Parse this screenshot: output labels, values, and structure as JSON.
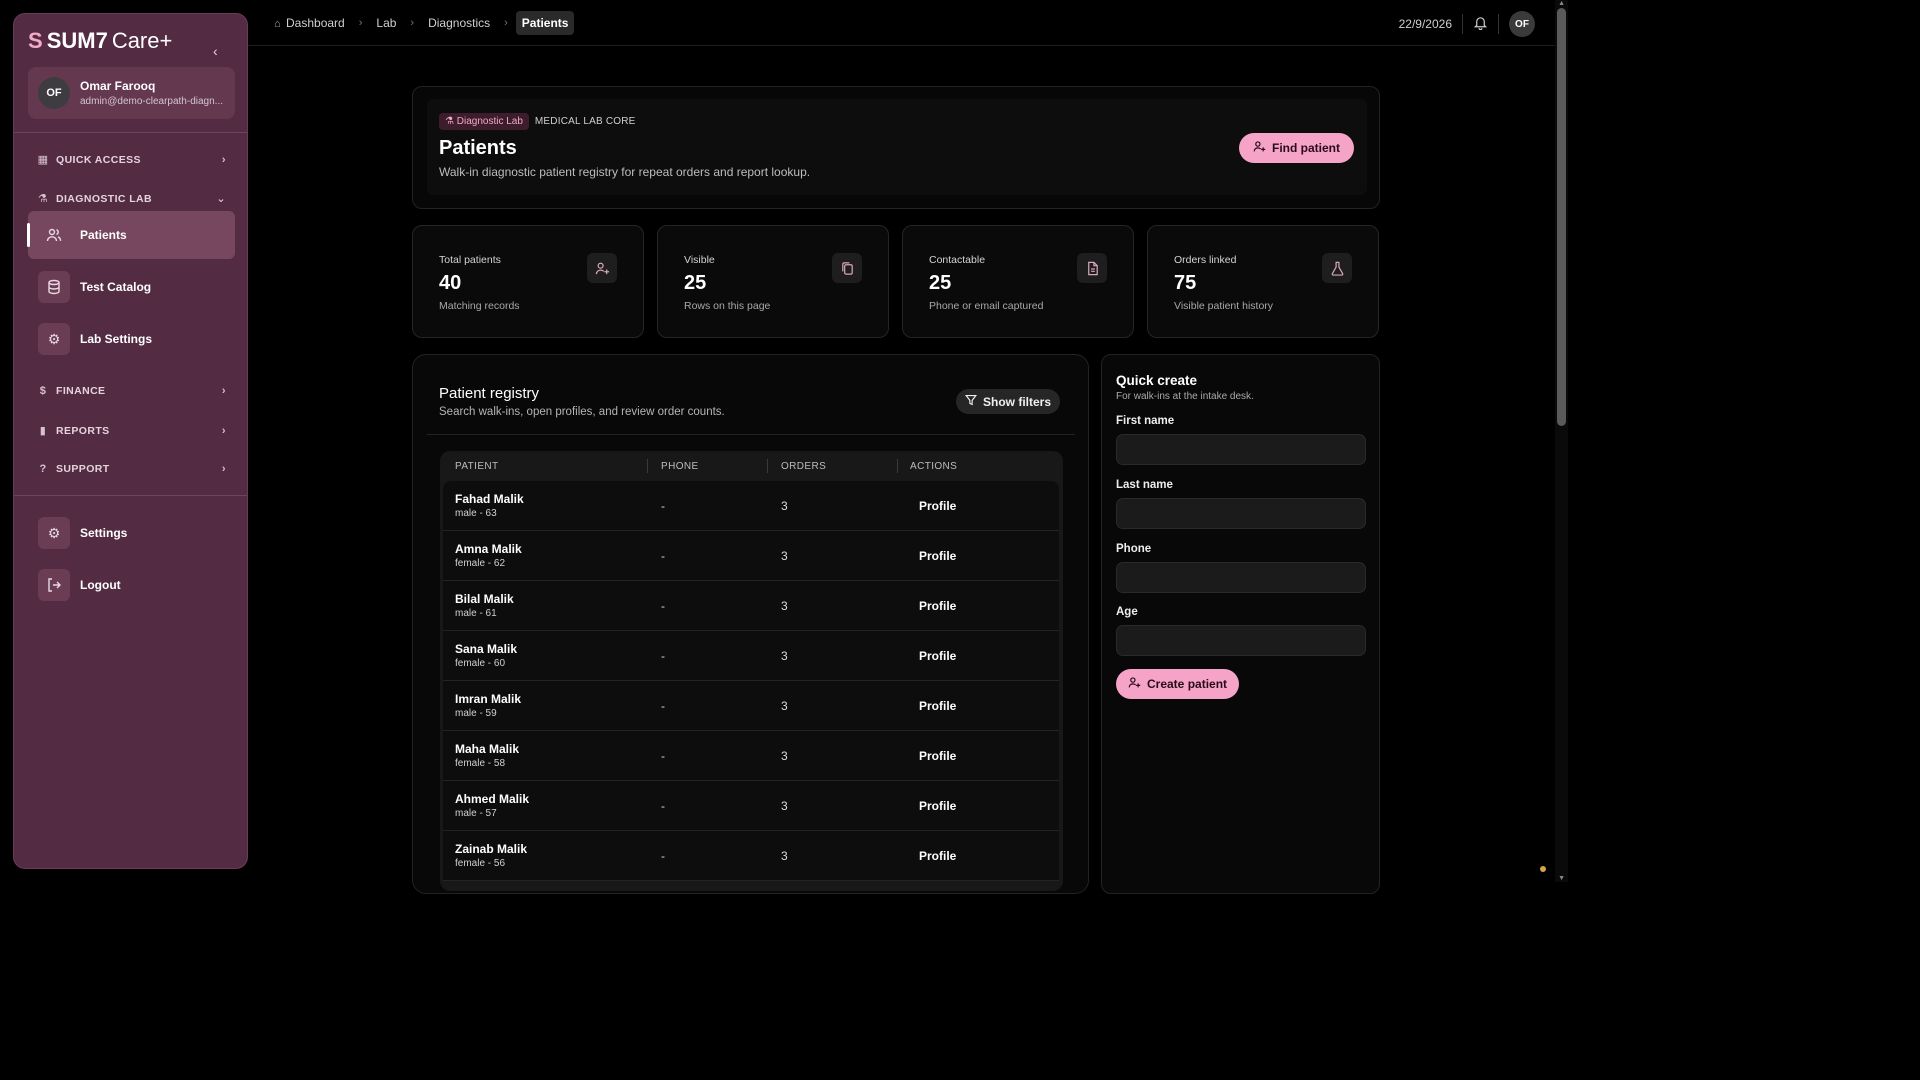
{
  "brand": {
    "logo": "S",
    "name": "SUM7",
    "suffix": "Care+"
  },
  "user": {
    "initials": "OF",
    "name": "Omar Farooq",
    "email": "admin@demo-clearpath-diagn..."
  },
  "sidebar": {
    "sections": [
      {
        "label": "QUICK ACCESS"
      },
      {
        "label": "DIAGNOSTIC LAB"
      },
      {
        "label": "FINANCE"
      },
      {
        "label": "REPORTS"
      },
      {
        "label": "SUPPORT"
      }
    ],
    "lab_items": [
      {
        "label": "Patients"
      },
      {
        "label": "Test Catalog"
      },
      {
        "label": "Lab Settings"
      }
    ],
    "bottom_items": [
      {
        "label": "Settings"
      },
      {
        "label": "Logout"
      }
    ]
  },
  "breadcrumb": [
    "Dashboard",
    "Lab",
    "Diagnostics",
    "Patients"
  ],
  "topbar": {
    "date": "22/9/2026",
    "avatar_initials": "OF"
  },
  "hero": {
    "tag": "Diagnostic Lab",
    "tag_sub": "MEDICAL LAB CORE",
    "title": "Patients",
    "description": "Walk-in diagnostic patient registry for repeat orders and report lookup.",
    "find_button": "Find patient"
  },
  "stats": [
    {
      "label": "Total patients",
      "value": "40",
      "sub": "Matching records",
      "icon": "user-plus-icon"
    },
    {
      "label": "Visible",
      "value": "25",
      "sub": "Rows on this page",
      "icon": "copy-icon"
    },
    {
      "label": "Contactable",
      "value": "25",
      "sub": "Phone or email captured",
      "icon": "file-icon"
    },
    {
      "label": "Orders linked",
      "value": "75",
      "sub": "Visible patient history",
      "icon": "flask-icon"
    }
  ],
  "registry": {
    "title": "Patient registry",
    "subtitle": "Search walk-ins, open profiles, and review order counts.",
    "filter_button": "Show filters",
    "columns": [
      "PATIENT",
      "PHONE",
      "ORDERS",
      "ACTIONS"
    ],
    "rows": [
      {
        "name": "Fahad Malik",
        "meta": "male - 63",
        "phone": "-",
        "orders": "3",
        "action": "Profile"
      },
      {
        "name": "Amna Malik",
        "meta": "female - 62",
        "phone": "-",
        "orders": "3",
        "action": "Profile"
      },
      {
        "name": "Bilal Malik",
        "meta": "male - 61",
        "phone": "-",
        "orders": "3",
        "action": "Profile"
      },
      {
        "name": "Sana Malik",
        "meta": "female - 60",
        "phone": "-",
        "orders": "3",
        "action": "Profile"
      },
      {
        "name": "Imran Malik",
        "meta": "male - 59",
        "phone": "-",
        "orders": "3",
        "action": "Profile"
      },
      {
        "name": "Maha Malik",
        "meta": "female - 58",
        "phone": "-",
        "orders": "3",
        "action": "Profile"
      },
      {
        "name": "Ahmed Malik",
        "meta": "male - 57",
        "phone": "-",
        "orders": "3",
        "action": "Profile"
      },
      {
        "name": "Zainab Malik",
        "meta": "female - 56",
        "phone": "-",
        "orders": "3",
        "action": "Profile"
      }
    ]
  },
  "quick_create": {
    "title": "Quick create",
    "subtitle": "For walk-ins at the intake desk.",
    "fields": [
      {
        "label": "First name",
        "value": ""
      },
      {
        "label": "Last name",
        "value": ""
      },
      {
        "label": "Phone",
        "value": ""
      },
      {
        "label": "Age",
        "value": ""
      }
    ],
    "create_button": "Create patient"
  },
  "colors": {
    "accent": "#f5a3c6",
    "sidebar_bg": "#532b43",
    "background": "#000000"
  }
}
